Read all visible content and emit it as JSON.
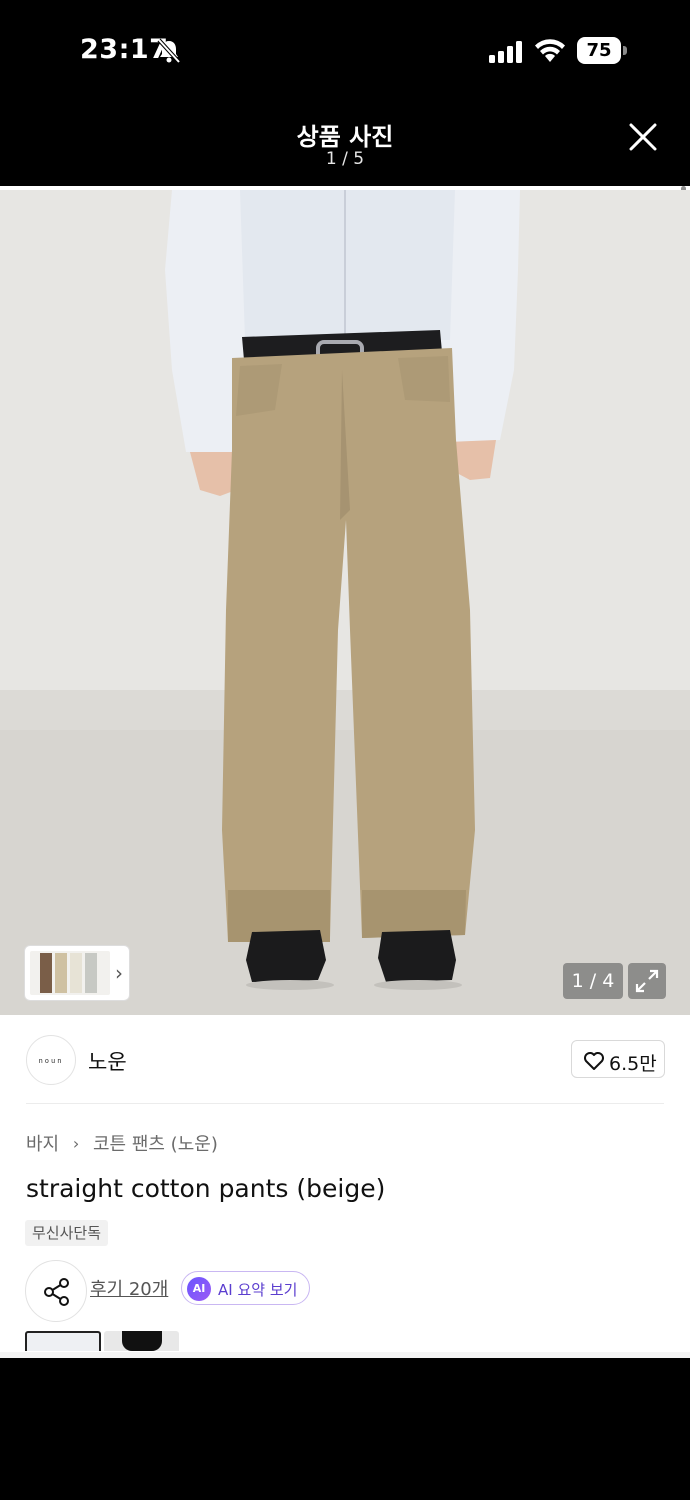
{
  "status_bar": {
    "time": "23:17",
    "battery": "75",
    "icons": [
      "bell-off-icon",
      "cellular-signal-icon",
      "wifi-icon",
      "battery-icon"
    ]
  },
  "header": {
    "title": "상품 사진",
    "counter": "1 / 5",
    "close_icon": "close-icon"
  },
  "photo": {
    "counter": "1 / 4",
    "expand_icon": "expand-icon",
    "thumb_chevron": "›"
  },
  "brand": {
    "logo_text": "noun",
    "name": "노운",
    "likes": "6.5만"
  },
  "product": {
    "breadcrumb": [
      "바지",
      "코튼 팬츠 (노운)"
    ],
    "breadcrumb_sep": "›",
    "title": "straight cotton pants (beige)",
    "tag": "무신사단독",
    "reviews": "후기 20개",
    "ai_badge": "AI",
    "ai_label": "AI 요약 보기"
  },
  "colors": {
    "pants": "#b8a47f",
    "shirt": "#e9edf3",
    "wall": "#e6e5e2",
    "floor": "#d6d4cf",
    "ai_accent": "#6a55ff"
  }
}
